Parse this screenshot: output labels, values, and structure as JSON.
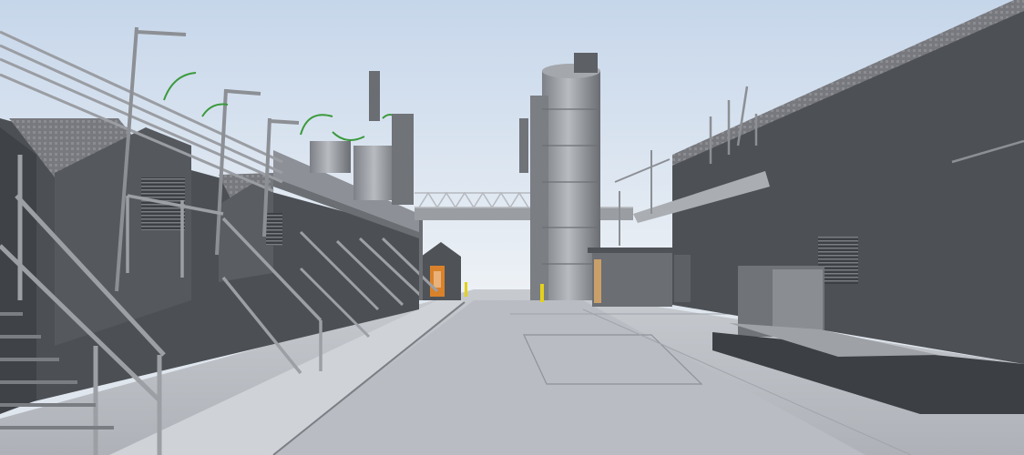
{
  "scene": {
    "description_visible_text": "",
    "colors": {
      "sky_top": "#c9d8ec",
      "sky_bottom": "#eef2f6",
      "wall_dark": "#4a4d52",
      "wall_mid": "#5a5d62",
      "ground": "#b8bcc2",
      "ground_light": "#c9ccd1",
      "metal": "#8d9096",
      "pipe_green": "#3c9a3c",
      "roof": "#6e7075",
      "door_orange": "#d9822b",
      "bollard_yellow": "#e4d11a"
    }
  }
}
